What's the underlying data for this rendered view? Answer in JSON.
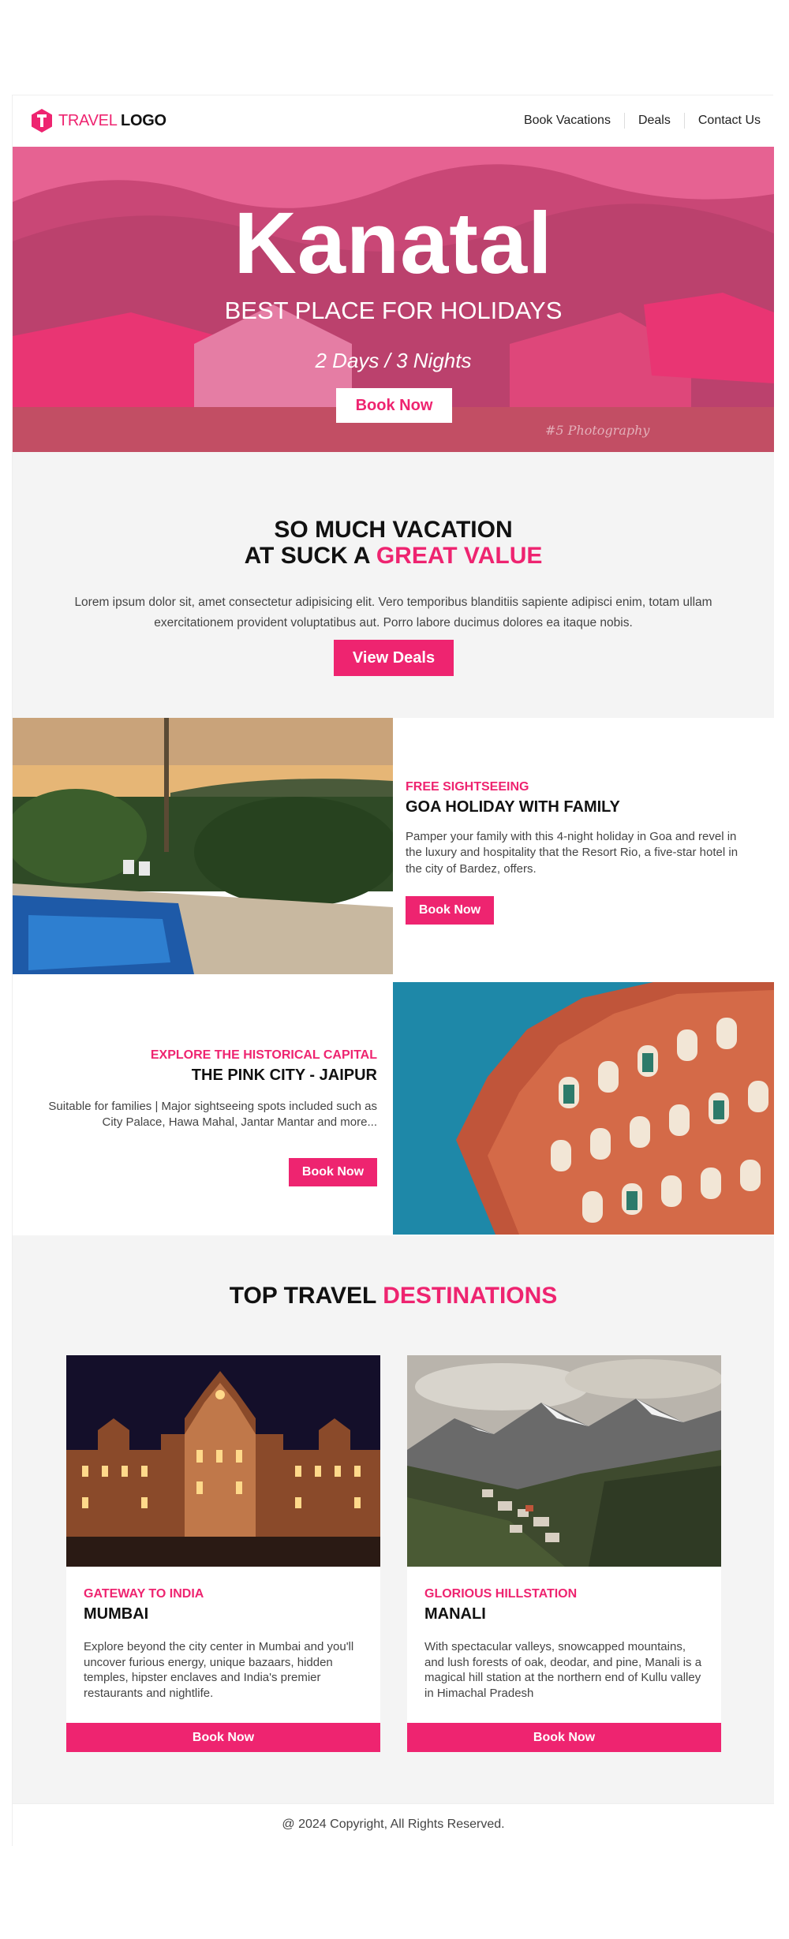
{
  "header": {
    "logo_text_1": "TRAVEL",
    "logo_text_2": "LOGO",
    "nav": [
      "Book Vacations",
      "Deals",
      "Contact Us"
    ]
  },
  "hero": {
    "title": "Kanatal",
    "subtitle": "BEST PLACE FOR HOLIDAYS",
    "duration": "2 Days / 3 Nights",
    "button": "Book Now",
    "watermark": "#5 Photography"
  },
  "vacation": {
    "line1": "SO MUCH VACATION",
    "line2_prefix": "AT SUCK A ",
    "line2_highlight": "GREAT VALUE",
    "paragraph": "Lorem ipsum dolor sit, amet consectetur adipisicing elit. Vero temporibus blanditiis sapiente adipisci enim, totam ullam exercitationem provident voluptatibus aut. Porro labore ducimus dolores ea itaque nobis.",
    "button": "View Deals"
  },
  "features": [
    {
      "eyebrow": "FREE SIGHTSEEING",
      "title": "GOA HOLIDAY WITH FAMILY",
      "description": "Pamper your family with this 4-night holiday in Goa and revel in the luxury and hospitality that the Resort Rio, a five-star hotel in the city of Bardez, offers.",
      "button": "Book Now"
    },
    {
      "eyebrow": "EXPLORE THE HISTORICAL CAPITAL",
      "title": "THE PINK CITY - JAIPUR",
      "description": "Suitable for families | Major sightseeing spots included such as City Palace, Hawa Mahal, Jantar Mantar and more...",
      "button": "Book Now"
    }
  ],
  "destinations": {
    "title_prefix": "TOP TRAVEL ",
    "title_highlight": "DESTINATIONS",
    "cards": [
      {
        "eyebrow": "GATEWAY TO INDIA",
        "title": "MUMBAI",
        "description": "Explore beyond the city center in Mumbai and you'll uncover furious energy, unique bazaars, hidden temples, hipster enclaves and India's premier restaurants and nightlife.",
        "button": "Book Now"
      },
      {
        "eyebrow": "GLORIOUS HILLSTATION",
        "title": "MANALI",
        "description": "With spectacular valleys, snowcapped mountains, and lush forests of oak, deodar, and pine, Manali is a magical hill station at the northern end of Kullu valley in Himachal Pradesh",
        "button": "Book Now"
      }
    ]
  },
  "footer": {
    "copyright": "@ 2024 Copyright, All Rights Reserved."
  },
  "colors": {
    "accent": "#ee2470",
    "section_bg": "#f4f4f4",
    "text": "#222222"
  }
}
